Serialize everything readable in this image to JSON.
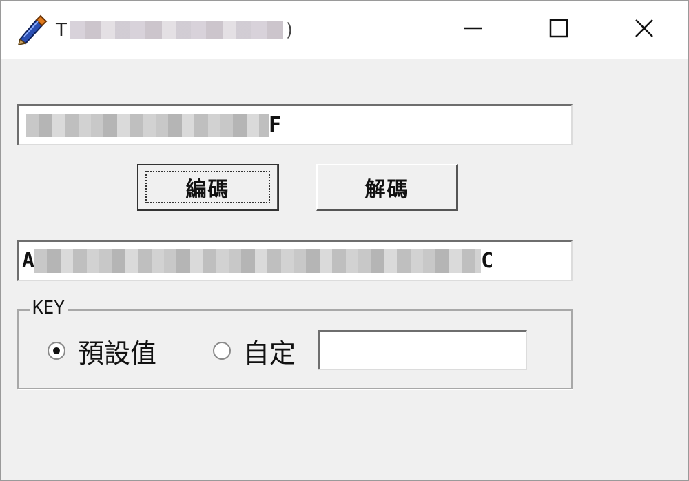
{
  "window": {
    "title_visible_start": "T",
    "title_visible_end": ")",
    "controls": {
      "minimize_icon": "minimize-icon",
      "maximize_icon": "maximize-icon",
      "close_icon": "close-icon"
    }
  },
  "main": {
    "input_field_tail": "F",
    "buttons": {
      "encode_label": "編碼",
      "decode_label": "解碼"
    },
    "output_field_head": "A",
    "output_field_tail": "C"
  },
  "key_group": {
    "legend": "KEY",
    "options": [
      {
        "label": "預設值",
        "selected": true
      },
      {
        "label": "自定",
        "selected": false
      }
    ],
    "custom_value": ""
  }
}
